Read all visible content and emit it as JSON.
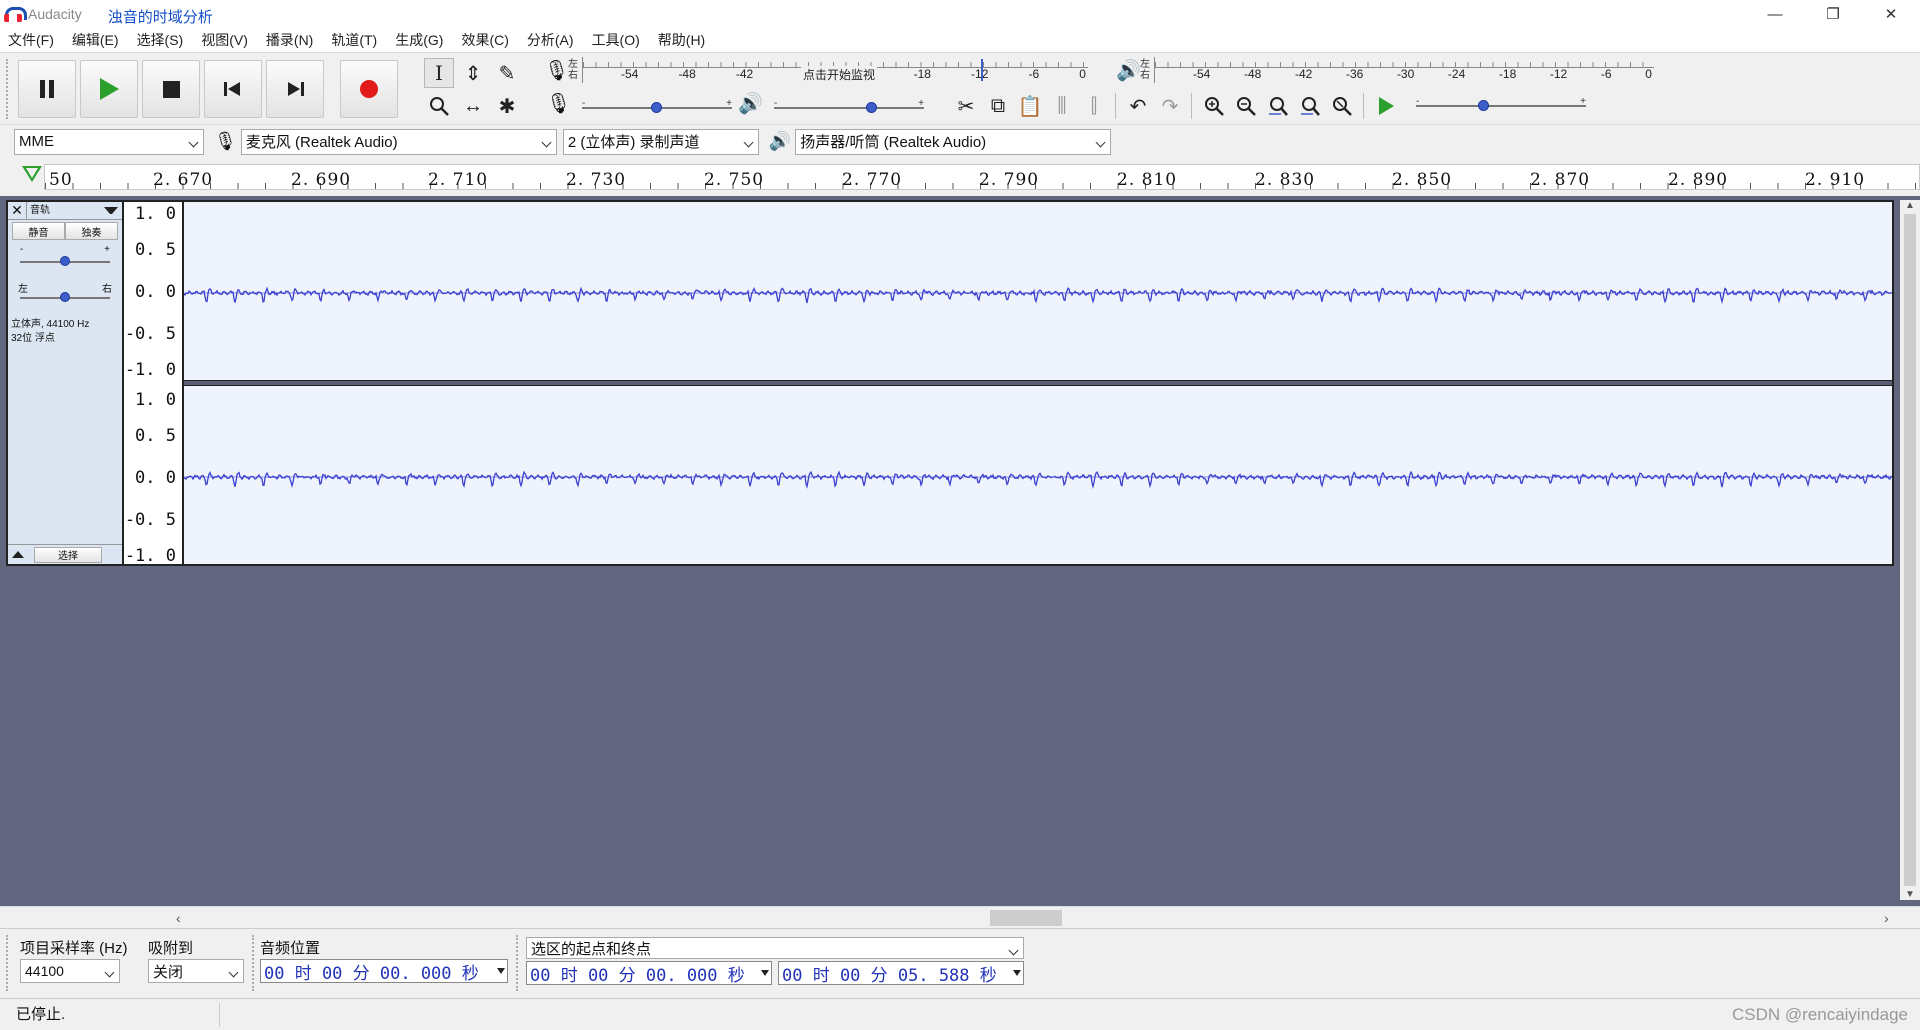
{
  "titlebar": {
    "app_name": "Audacity",
    "window_title": "浊音的时域分析",
    "minimize": "—",
    "restore": "❐",
    "close": "✕"
  },
  "menu": [
    "文件(F)",
    "编辑(E)",
    "选择(S)",
    "视图(V)",
    "播录(N)",
    "轨道(T)",
    "生成(G)",
    "效果(C)",
    "分析(A)",
    "工具(O)",
    "帮助(H)"
  ],
  "transport": {
    "buttons": [
      "pause-icon",
      "play-icon",
      "stop-icon",
      "skip-to-start-icon",
      "skip-to-end-icon",
      "record-icon"
    ]
  },
  "tools": {
    "selection": "I",
    "envelope": "⇕",
    "draw": "✎",
    "zoom": "🔍",
    "timeshift": "↔",
    "multi": "✱"
  },
  "record_meter": {
    "lr_top": "左",
    "lr_bottom": "右",
    "labels": [
      "-54",
      "-48",
      "-42",
      "",
      "",
      "",
      "-18",
      "-12",
      "-6",
      "0"
    ],
    "monitor_text": "点击开始监视"
  },
  "play_meter": {
    "lr_top": "左",
    "lr_bottom": "右",
    "labels": [
      "-54",
      "-48",
      "-42",
      "-36",
      "-30",
      "-24",
      "-18",
      "-12",
      "-6",
      "0"
    ]
  },
  "mixer": {
    "rec_volume": 0.5,
    "play_volume": 0.65,
    "play_speed": 0.4,
    "minus": "-",
    "plus": "+"
  },
  "edit_toolbar": [
    "cut-icon",
    "copy-icon",
    "paste-icon",
    "trim-icon",
    "silence-icon",
    "undo-icon",
    "redo-icon",
    "zoom-in-icon",
    "zoom-out-icon",
    "fit-selection-icon",
    "fit-project-icon",
    "zoom-toggle-icon",
    "play-at-speed-icon"
  ],
  "device_bar": {
    "host": "MME",
    "input": "麦克风 (Realtek Audio)",
    "channels": "2 (立体声) 录制声道",
    "output": "扬声器/听筒 (Realtek Audio)"
  },
  "timeline": {
    "labels": [
      "50",
      "2. 670",
      "2. 690",
      "2. 710",
      "2. 730",
      "2. 750",
      "2. 770",
      "2. 790",
      "2. 810",
      "2. 830",
      "2. 850",
      "2. 870",
      "2. 890",
      "2. 910"
    ]
  },
  "track": {
    "name": "音轨",
    "mute": "静音",
    "solo": "独奏",
    "gain_minus": "-",
    "gain_plus": "+",
    "pan_left": "左",
    "pan_right": "右",
    "info_line1": "立体声, 44100 Hz",
    "info_line2": "32位 浮点",
    "select": "选择",
    "gain": 0.5,
    "pan": 0.5,
    "amplitude_labels": [
      "1. 0",
      "0. 5",
      "0. 0",
      "-0. 5",
      "-1. 0"
    ]
  },
  "selection_bar": {
    "rate_label": "项目采样率 (Hz)",
    "rate_value": "44100",
    "snap_label": "吸附到",
    "snap_value": "关闭",
    "audio_pos_label": "音频位置",
    "audio_pos_value": "00 时 00 分 00. 000 秒",
    "sel_label": "选区的起点和终点",
    "sel_start": "00 时 00 分 00. 000 秒",
    "sel_end": "00 时 00 分 05. 588 秒"
  },
  "status": {
    "text": "已停止."
  },
  "watermark": "CSDN @rencaiyindage",
  "colors": {
    "waveform": "#3b3fd0",
    "track_bg": "#eef3fc",
    "canvas_bg": "#63667f",
    "play_green": "#2ca02c",
    "record_red": "#e21a1a"
  }
}
